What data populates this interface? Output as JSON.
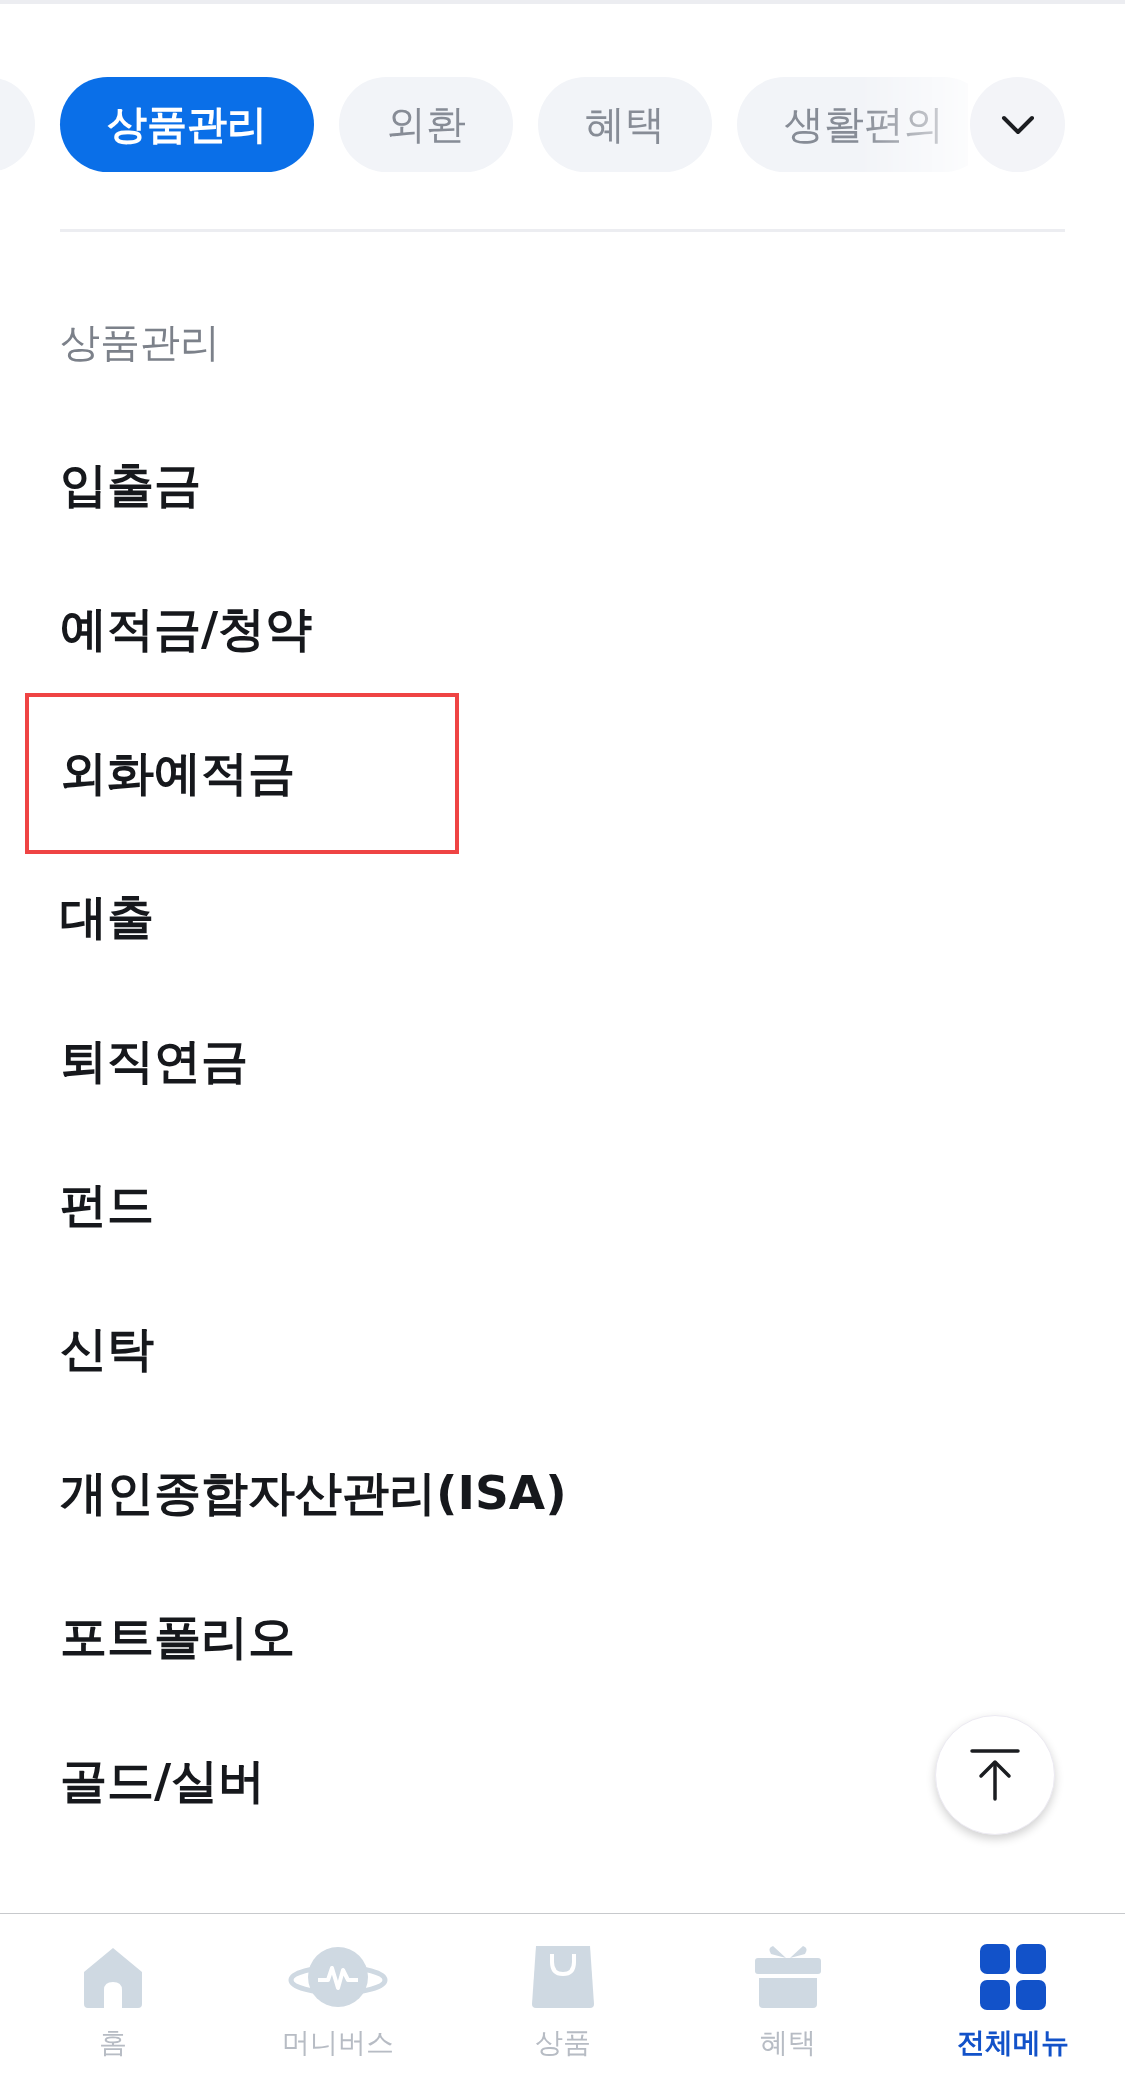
{
  "category_tabs": [
    {
      "label": "상품관리",
      "selected": true
    },
    {
      "label": "외환",
      "selected": false
    },
    {
      "label": "혜택",
      "selected": false
    },
    {
      "label": "생활편의",
      "selected": false
    }
  ],
  "section": {
    "title": "상품관리",
    "items": [
      {
        "label": "입출금",
        "highlighted": false
      },
      {
        "label": "예적금/청약",
        "highlighted": false
      },
      {
        "label": "외화예적금",
        "highlighted": true
      },
      {
        "label": "대출",
        "highlighted": false
      },
      {
        "label": "퇴직연금",
        "highlighted": false
      },
      {
        "label": "펀드",
        "highlighted": false
      },
      {
        "label": "신탁",
        "highlighted": false
      },
      {
        "label": "개인종합자산관리(ISA)",
        "highlighted": false
      },
      {
        "label": "포트폴리오",
        "highlighted": false
      },
      {
        "label": "골드/실버",
        "highlighted": false
      }
    ]
  },
  "bottom_nav": [
    {
      "kind": "home",
      "label": "홈",
      "selected": false
    },
    {
      "kind": "planet",
      "label": "머니버스",
      "selected": false
    },
    {
      "kind": "bag",
      "label": "상품",
      "selected": false
    },
    {
      "kind": "gift",
      "label": "혜택",
      "selected": false
    },
    {
      "kind": "grid",
      "label": "전체메뉴",
      "selected": true
    }
  ]
}
